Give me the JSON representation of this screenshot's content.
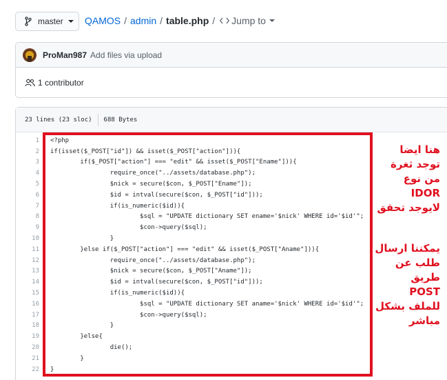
{
  "breadcrumb": {
    "branch": "master",
    "repo": "QAMOS",
    "folder": "admin",
    "file": "table.php",
    "separator": "/",
    "jump_to": "Jump to"
  },
  "commit": {
    "author": "ProMan987",
    "message": "Add files via upload",
    "contributors": "1 contributor"
  },
  "file_info": {
    "lines": "23 lines (23 sloc)",
    "size": "688 Bytes"
  },
  "code_lines": [
    {
      "n": "1"
    },
    {
      "n": "2"
    },
    {
      "n": "3"
    },
    {
      "n": "4"
    },
    {
      "n": "5"
    },
    {
      "n": "6"
    },
    {
      "n": "7"
    },
    {
      "n": "8"
    },
    {
      "n": "9"
    },
    {
      "n": "10"
    },
    {
      "n": "11"
    },
    {
      "n": "12"
    },
    {
      "n": "13"
    },
    {
      "n": "14"
    },
    {
      "n": "15"
    },
    {
      "n": "16"
    },
    {
      "n": "17"
    },
    {
      "n": "18"
    },
    {
      "n": "19"
    },
    {
      "n": "20"
    },
    {
      "n": "21"
    },
    {
      "n": "22"
    }
  ],
  "code": [
    "<?php",
    "if(isset($_POST[\"id\"]) && isset($_POST[\"action\"])){",
    "        if($_POST[\"action\"] === \"edit\" && isset($_POST[\"Ename\"])){",
    "                require_once(\"../assets/database.php\");",
    "                $nick = secure($con, $_POST[\"Ename\"]);",
    "                $id = intval(secure($con, $_POST[\"id\"]));",
    "                if(is_numeric($id)){",
    "                        $sql = \"UPDATE dictionary SET ename='$nick' WHERE id='$id'\";",
    "                        $con->query($sql);",
    "                }",
    "        }else if($_POST[\"action\"] === \"edit\" && isset($_POST[\"Aname\"])){",
    "                require_once(\"../assets/database.php\");",
    "                $nick = secure($con, $_POST[\"Aname\"]);",
    "                $id = intval(secure($con, $_POST[\"id\"]));",
    "                if(is_numeric($id)){",
    "                        $sql = \"UPDATE dictionary SET aname='$nick' WHERE id='$id'\";",
    "                        $con->query($sql);",
    "                }",
    "        }else{",
    "                die();",
    "        }",
    "}"
  ],
  "annotation": {
    "block1": [
      "هنا ايضا",
      "توجد ثغرة",
      "من نوع",
      "IDOR",
      "لايوجد تحقق"
    ],
    "block2": [
      "يمكننا ارسال",
      "طلب عن طريق",
      "POST",
      "للملف بشكل",
      "مباشر"
    ]
  },
  "colors": {
    "highlight": "#e0101f",
    "link": "#0366d6"
  }
}
